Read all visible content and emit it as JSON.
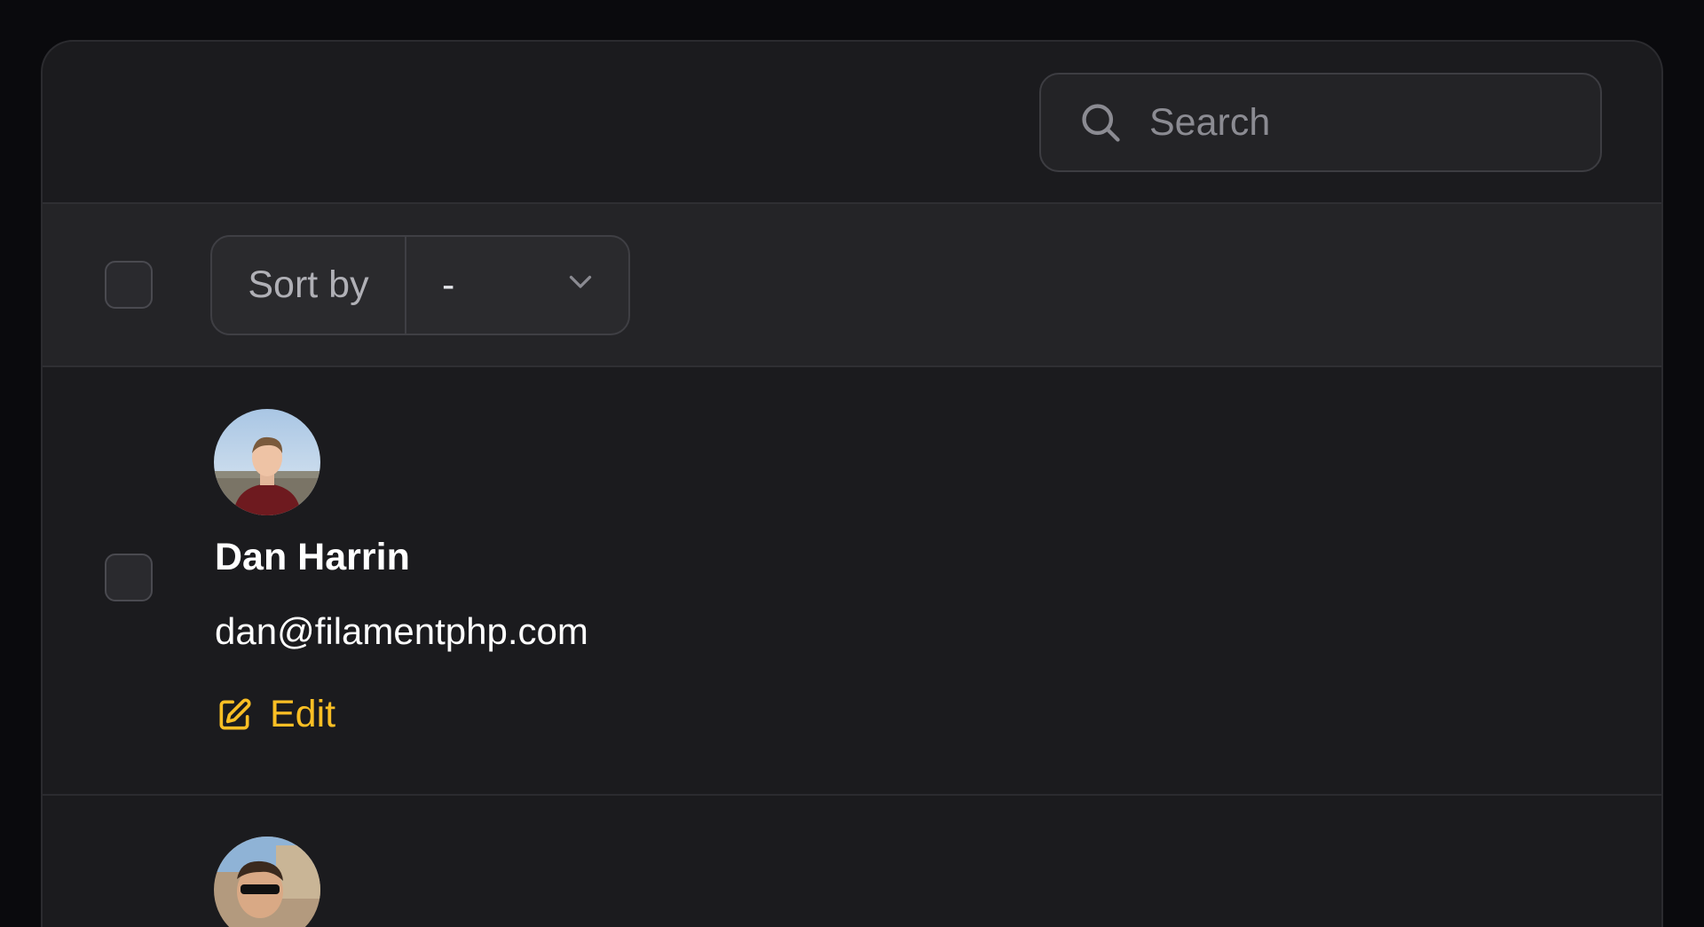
{
  "search": {
    "placeholder": "Search",
    "icon": "search-icon"
  },
  "toolbar": {
    "sort_label": "Sort by",
    "sort_value": "-",
    "sort_icon": "chevron-down-icon"
  },
  "records": [
    {
      "name": "Dan Harrin",
      "email": "dan@filamentphp.com",
      "edit_label": "Edit",
      "edit_icon": "pencil-square-icon"
    }
  ],
  "colors": {
    "background": "#0a0a0d",
    "card": "#1b1b1e",
    "accent": "#fbbf24"
  }
}
